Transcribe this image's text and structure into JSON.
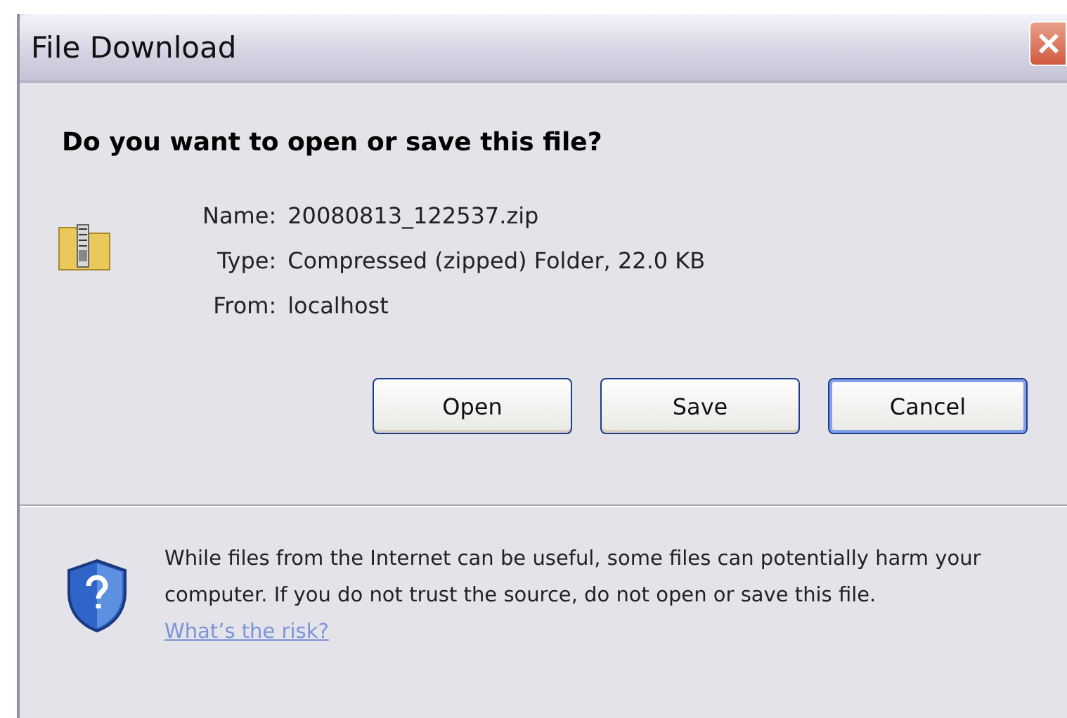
{
  "window": {
    "title": "File Download"
  },
  "question": "Do you want to open or save this file?",
  "details": [
    {
      "label": "Name:",
      "value": "20080813_122537.zip"
    },
    {
      "label": "Type:",
      "value": "Compressed (zipped) Folder, 22.0 KB"
    },
    {
      "label": "From:",
      "value": "localhost"
    }
  ],
  "buttons": [
    {
      "label": "Open",
      "selected": false
    },
    {
      "label": "Save",
      "selected": false
    },
    {
      "label": "Cancel",
      "selected": true
    }
  ],
  "warning": {
    "text": "While files from the Internet can be useful, some files can potentially harm your computer. If you do not trust the source, do not open or save this file.",
    "link": "What’s the risk?"
  }
}
